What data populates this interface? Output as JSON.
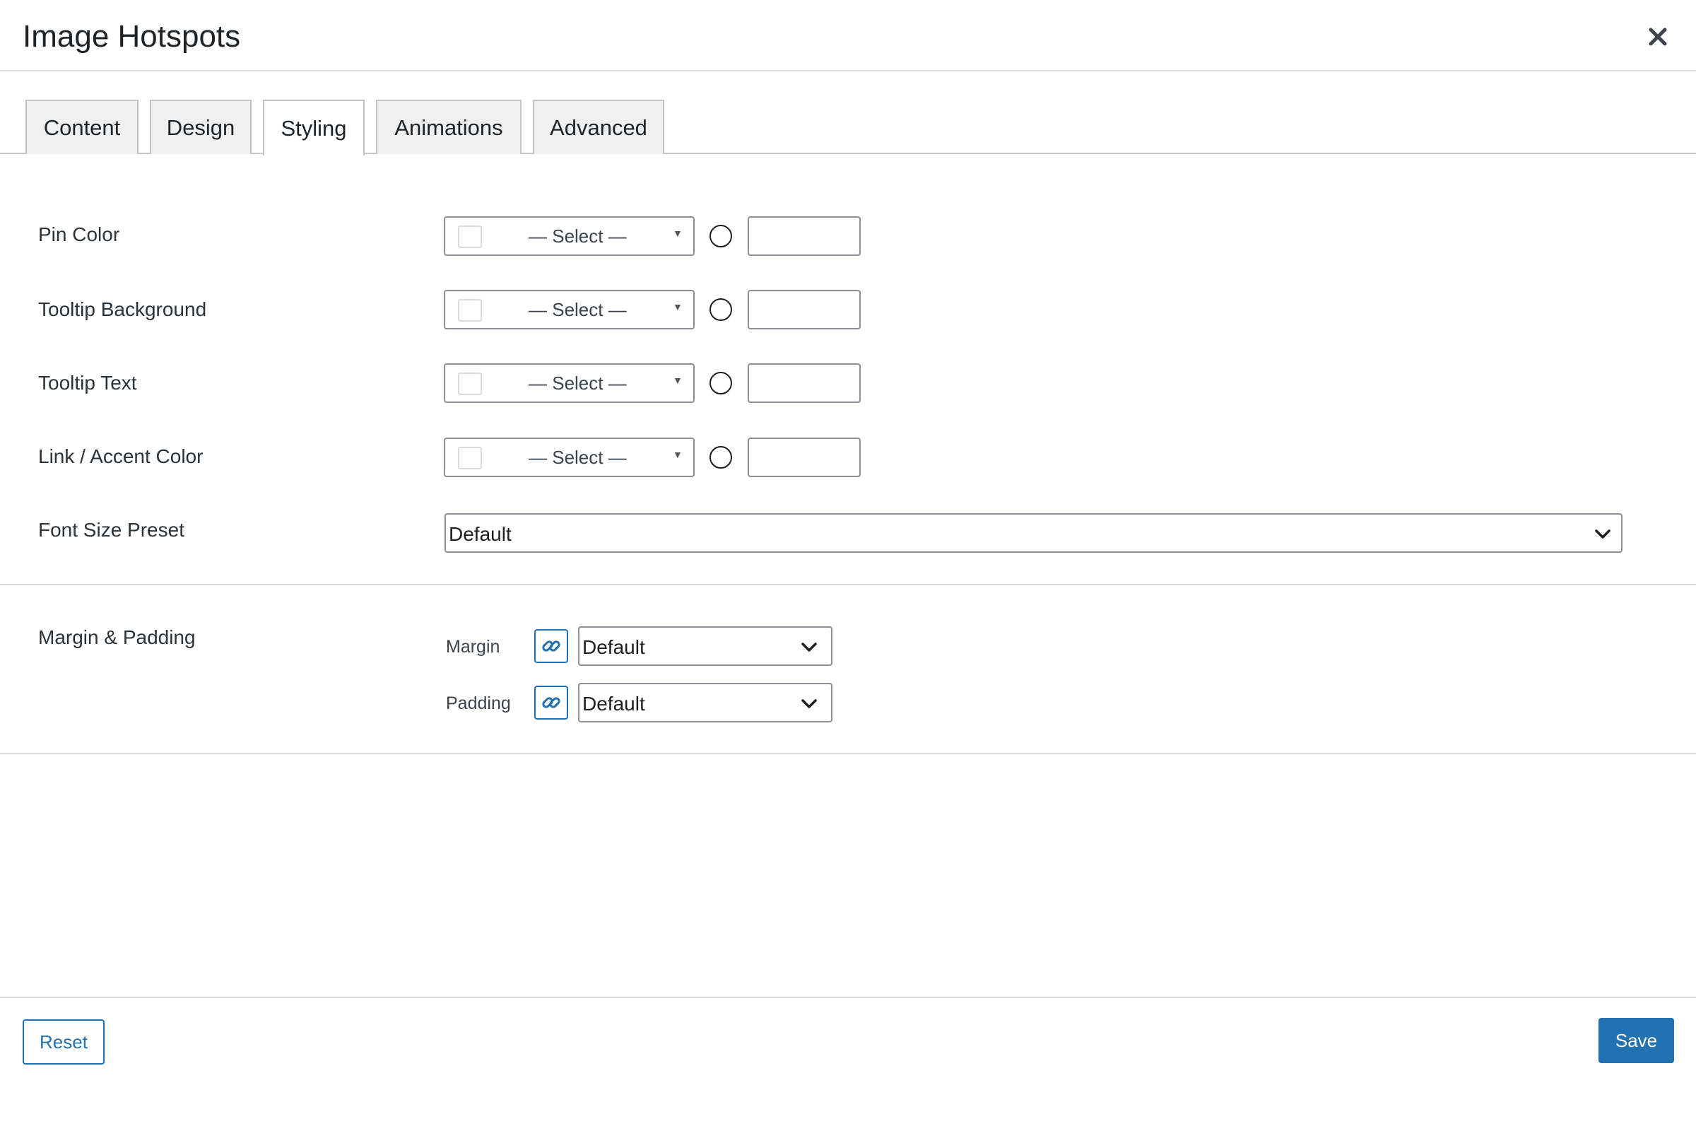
{
  "modal": {
    "title": "Image Hotspots",
    "close_icon": "close-icon"
  },
  "tabs": [
    {
      "label": "Content",
      "active": false
    },
    {
      "label": "Design",
      "active": false
    },
    {
      "label": "Styling",
      "active": true
    },
    {
      "label": "Animations",
      "active": false
    },
    {
      "label": "Advanced",
      "active": false
    }
  ],
  "color_rows": [
    {
      "label": "Pin Color",
      "select_text": "— Select —",
      "value": ""
    },
    {
      "label": "Tooltip Background",
      "select_text": "— Select —",
      "value": ""
    },
    {
      "label": "Tooltip Text",
      "select_text": "— Select —",
      "value": ""
    },
    {
      "label": "Link / Accent Color",
      "select_text": "— Select —",
      "value": ""
    }
  ],
  "font_size": {
    "label": "Font Size Preset",
    "value": "Default"
  },
  "spacing": {
    "label": "Margin & Padding",
    "margin_label": "Margin",
    "margin_value": "Default",
    "padding_label": "Padding",
    "padding_value": "Default"
  },
  "footer": {
    "reset_label": "Reset",
    "save_label": "Save"
  },
  "colors": {
    "accent": "#2271b1",
    "border": "#8c8f94",
    "tab_bg": "#f0f0f1"
  }
}
